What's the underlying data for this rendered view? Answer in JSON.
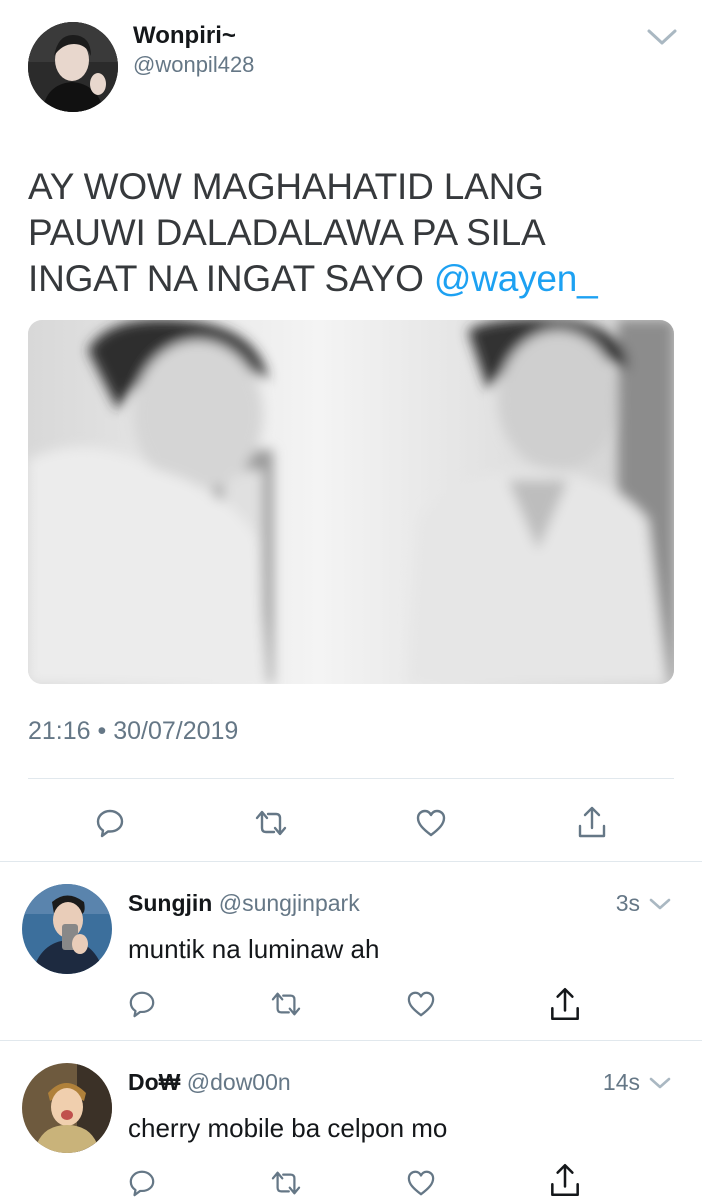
{
  "tweet": {
    "display_name": "Wonpiri~",
    "handle": "@wonpil428",
    "text_lines": [
      "AY WOW MAGHAHATID LANG",
      "PAUWI DALADALAWA PA SILA",
      "INGAT NA INGAT SAYO "
    ],
    "mention": "@wayen_",
    "timestamp": "21:16 • 30/07/2019"
  },
  "replies": [
    {
      "display_name": "Sungjin",
      "handle": "@sungjinpark",
      "time": "3s",
      "text": "muntik na luminaw ah"
    },
    {
      "display_name": "Do₩",
      "handle": "@dow00n",
      "time": "14s",
      "text": "cherry mobile ba celpon mo"
    }
  ],
  "icons": {
    "reply": "reply-icon",
    "retweet": "retweet-icon",
    "like": "heart-icon",
    "share": "share-icon",
    "caret": "chevron-down-icon"
  },
  "colors": {
    "accent": "#1da1f2",
    "secondary_text": "#657786",
    "icon": "#657786",
    "divider": "#e1e8ed"
  }
}
